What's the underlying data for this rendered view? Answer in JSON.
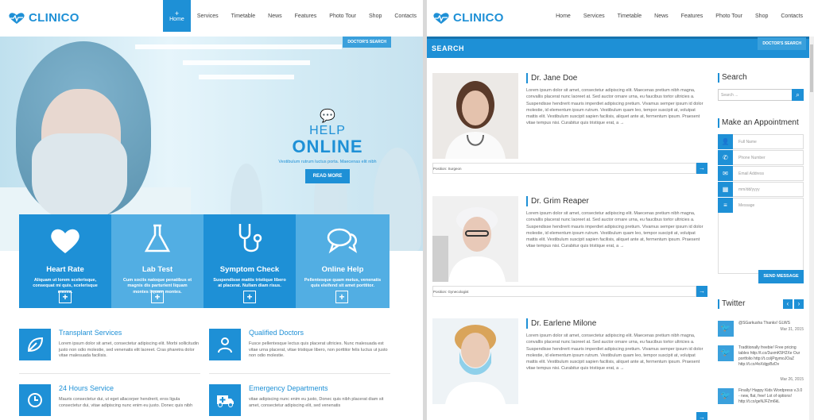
{
  "left": {
    "logo": "CLINICO",
    "nav": [
      "Home",
      "Services",
      "Timetable",
      "News",
      "Features",
      "Photo Tour",
      "Shop",
      "Contacts"
    ],
    "doctors_search_tag": "DOCTOR'S SEARCH",
    "hero": {
      "help1": "HELP",
      "help2": "ONLINE",
      "sub": "Vestibulum rutrum luctus porta. Maecenas elit nibh",
      "button": "READ MORE"
    },
    "features": [
      {
        "title": "Heart Rate",
        "desc": "Aliquam ut lorem scelerisque, consequat mi quis, scelerisque massa.",
        "color": "#1e90d6",
        "icon": "heart-icon"
      },
      {
        "title": "Lab Test",
        "desc": "Cum sociis natoque penatibus et magnis dis parturient liquam montes liquam montes.",
        "color": "#52aee3",
        "icon": "flask-icon"
      },
      {
        "title": "Symptom Check",
        "desc": "Suspendisse mattis tristique libero at placerat. Nullam diam risus.",
        "color": "#1e90d6",
        "icon": "stethoscope-icon"
      },
      {
        "title": "Online Help",
        "desc": "Pellentesque quam metus, venenatis quis eleifend sit amet porttitor.",
        "color": "#52aee3",
        "icon": "chat-icon"
      }
    ],
    "services": [
      {
        "title": "Transplant Services",
        "desc": "Lorem ipsum dolor sit amet, consectetur adipiscing elit. Morbi sollicitudin justo non odio molestie, sed venenatis elit laoreet. Cras pharetra dolor vitae malesuada facilisis.",
        "icon": "leaf-icon"
      },
      {
        "title": "Qualified Doctors",
        "desc": "Fusce pellentesque lectus quis placerat ultricies. Nunc malesuada est vitae urna placerat, vitae tristique libero, non porttitor felis luctus ut justo non odio molestie.",
        "icon": "doctor-icon"
      },
      {
        "title": "24 Hours Service",
        "desc": "Mauris consectetur dui, ut eget allacorper hendrerit, eros ligula consectetur dui, vitae adipiscing nunc enim eu justo. Donec quis nibh",
        "icon": "clock-icon"
      },
      {
        "title": "Emergency Departments",
        "desc": "vitae adipiscing nunc enim eu justo, Donec quis nibh placerat diam sit amet, consectetur adipiscing elit, sed venenatis",
        "icon": "ambulance-icon"
      }
    ]
  },
  "right": {
    "logo": "CLINICO",
    "nav": [
      "Home",
      "Services",
      "Timetable",
      "News",
      "Features",
      "Photo Tour",
      "Shop",
      "Contacts"
    ],
    "bar_label": "SEARCH",
    "doctors_search_tag": "DOCTOR'S SEARCH",
    "doctors": [
      {
        "name": "Dr. Jane Doe",
        "position": "Position: Surgeon"
      },
      {
        "name": "Dr. Grim Reaper",
        "position": "Position: Gynecologist"
      },
      {
        "name": "Dr. Earlene Milone",
        "position": ""
      }
    ],
    "lorem": "Lorem ipsum dolor sit amet, consectetur adipiscing elit. Maecenas pretium nibh magna, convallis placerat nunc laoreet at. Sed auctor ornare urna, eu faucibus tortor ultricies a. Suspendisse hendrerit mauris imperdiet adipiscing pretium. Vivamus semper ipsum id dolor molestie, id elementum ipsum rutrum. Vestibulum quam leo, tempor suscipit at, volutpat mattis elit. Vestibulum suscipit sapien facilisis, aliquet ante at, fermentum ipsum. Praesent vitae tempus nisi. Curabitur quis tristique erat, a →",
    "search_title": "Search",
    "search_placeholder": "Search ...",
    "appointment_title": "Make an Appointment",
    "fields": [
      {
        "label": "Full Name",
        "icon": "user-icon"
      },
      {
        "label": "Phone Number",
        "icon": "phone-icon"
      },
      {
        "label": "Email Address",
        "icon": "mail-icon"
      },
      {
        "label": "mm/dd/yyyy",
        "icon": "calendar-icon"
      },
      {
        "label": "Message",
        "icon": "message-icon"
      }
    ],
    "send": "SEND MESSAGE",
    "twitter_title": "Twitter",
    "tweets": [
      {
        "text": "@SGarkusha Thanks! GLWS",
        "date": "Mar 31, 2015"
      },
      {
        "text": "Traditionally freebie! Free pricing tables http://t.co/3uxmK5H2Xe Our portfolio http://t.co/jPqymoJOaZ http://t.co/4oXdgpBzDv",
        "date": "Mar 26, 2015"
      },
      {
        "text": "Finally! Happy Kids Wordpress v.3.0 - new, flat, free! Lot of options! http://t.co/geNJFZm6kL",
        "date": ""
      }
    ]
  }
}
